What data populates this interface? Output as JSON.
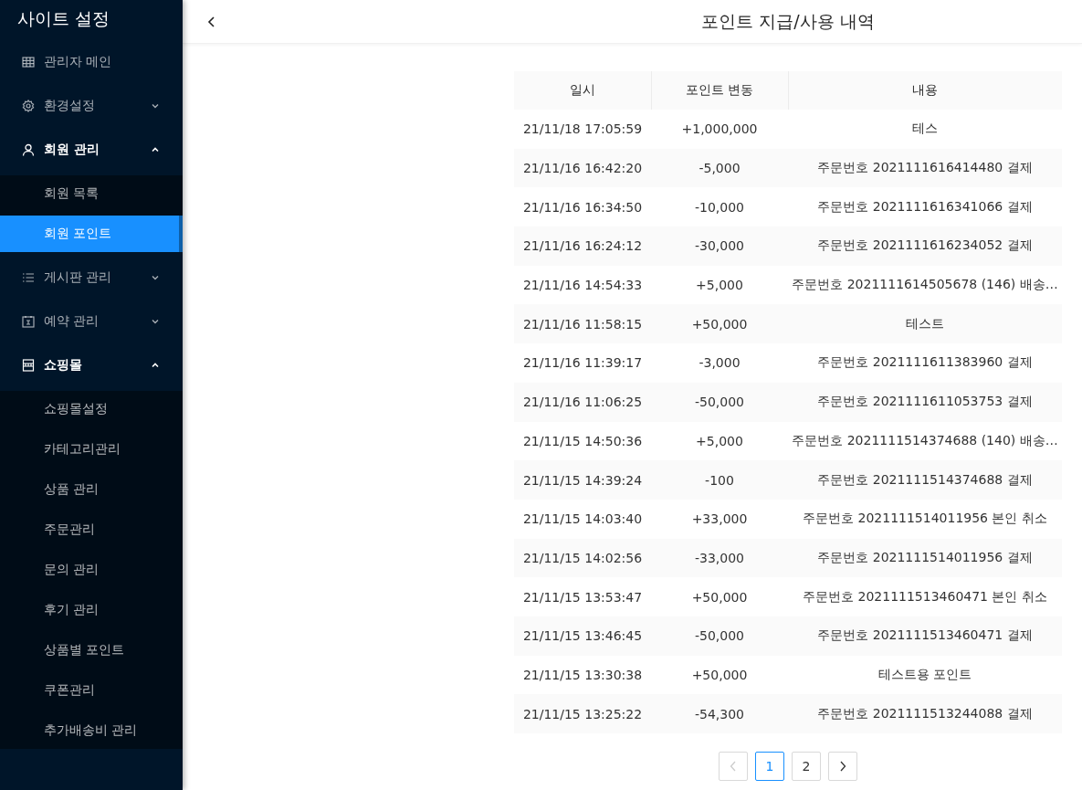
{
  "sidebar": {
    "title": "사이트 설정",
    "items": [
      {
        "label": "관리자 메인"
      },
      {
        "label": "환경설정",
        "expanded": false
      },
      {
        "label": "회원 관리",
        "expanded": true,
        "children": [
          {
            "label": "회원 목록",
            "selected": false
          },
          {
            "label": "회원 포인트",
            "selected": true
          }
        ]
      },
      {
        "label": "게시판 관리",
        "expanded": false
      },
      {
        "label": "예약 관리",
        "expanded": false
      },
      {
        "label": "쇼핑몰",
        "expanded": true,
        "children": [
          {
            "label": "쇼핑몰설정",
            "selected": false
          },
          {
            "label": "카테고리관리",
            "selected": false
          },
          {
            "label": "상품 관리",
            "selected": false
          },
          {
            "label": "주문관리",
            "selected": false
          },
          {
            "label": "문의 관리",
            "selected": false
          },
          {
            "label": "후기 관리",
            "selected": false
          },
          {
            "label": "상품별 포인트",
            "selected": false
          },
          {
            "label": "쿠폰관리",
            "selected": false
          },
          {
            "label": "추가배송비 관리",
            "selected": false
          }
        ]
      }
    ]
  },
  "header": {
    "title": "포인트 지급/사용 내역"
  },
  "table": {
    "columns": [
      "일시",
      "포인트 변동",
      "내용"
    ],
    "rows": [
      [
        "21/11/18 17:05:59",
        "+1,000,000",
        "테스"
      ],
      [
        "21/11/16 16:42:20",
        "-5,000",
        "주문번호 2021111616414480 결제"
      ],
      [
        "21/11/16 16:34:50",
        "-10,000",
        "주문번호 2021111616341066 결제"
      ],
      [
        "21/11/16 16:24:12",
        "-30,000",
        "주문번호 2021111616234052 결제"
      ],
      [
        "21/11/16 14:54:33",
        "+5,000",
        "주문번호 2021111614505678 (146) 배송…"
      ],
      [
        "21/11/16 11:58:15",
        "+50,000",
        "테스트"
      ],
      [
        "21/11/16 11:39:17",
        "-3,000",
        "주문번호 2021111611383960 결제"
      ],
      [
        "21/11/16 11:06:25",
        "-50,000",
        "주문번호 2021111611053753 결제"
      ],
      [
        "21/11/15 14:50:36",
        "+5,000",
        "주문번호 2021111514374688 (140) 배송…"
      ],
      [
        "21/11/15 14:39:24",
        "-100",
        "주문번호 2021111514374688 결제"
      ],
      [
        "21/11/15 14:03:40",
        "+33,000",
        "주문번호 2021111514011956 본인 취소"
      ],
      [
        "21/11/15 14:02:56",
        "-33,000",
        "주문번호 2021111514011956 결제"
      ],
      [
        "21/11/15 13:53:47",
        "+50,000",
        "주문번호 2021111513460471 본인 취소"
      ],
      [
        "21/11/15 13:46:45",
        "-50,000",
        "주문번호 2021111513460471 결제"
      ],
      [
        "21/11/15 13:30:38",
        "+50,000",
        "테스트용 포인트"
      ],
      [
        "21/11/15 13:25:22",
        "-54,300",
        "주문번호 2021111513244088 결제"
      ]
    ]
  },
  "pagination": {
    "prev_disabled": true,
    "next_disabled": false,
    "pages": [
      {
        "label": "1",
        "selected": true
      },
      {
        "label": "2",
        "selected": false
      }
    ]
  }
}
